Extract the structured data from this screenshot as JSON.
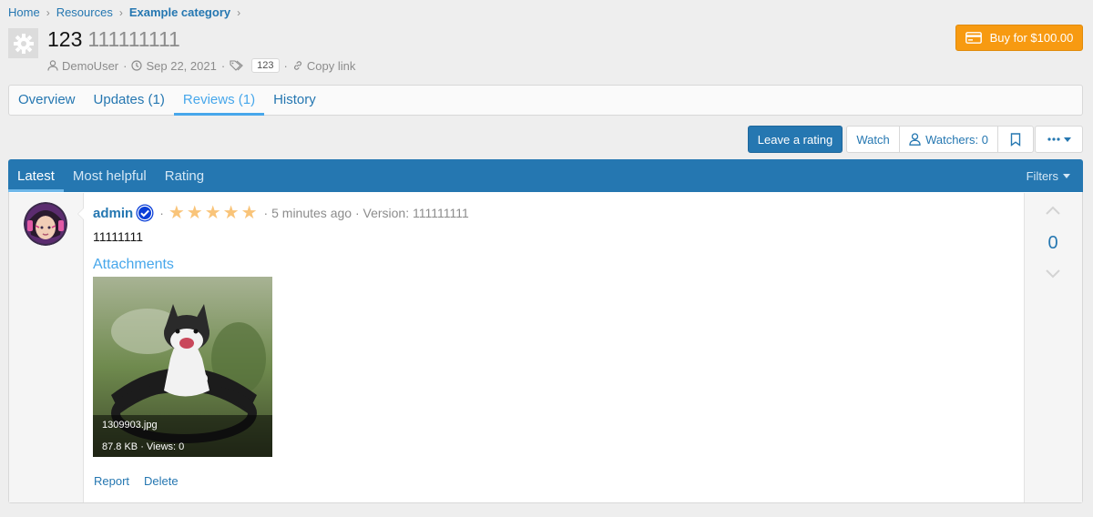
{
  "breadcrumb": [
    {
      "label": "Home",
      "bold": false
    },
    {
      "label": "Resources",
      "bold": false
    },
    {
      "label": "Example category",
      "bold": true
    }
  ],
  "resource": {
    "name": "123",
    "version": "111111111",
    "author": "DemoUser",
    "date": "Sep 22, 2021",
    "tag": "123",
    "copy_link": "Copy link",
    "buy_label": "Buy for $100.00"
  },
  "tabs": [
    {
      "label": "Overview",
      "active": false
    },
    {
      "label": "Updates (1)",
      "active": false
    },
    {
      "label": "Reviews (1)",
      "active": true
    },
    {
      "label": "History",
      "active": false
    }
  ],
  "actions_bar": {
    "leave_rating": "Leave a rating",
    "watch": "Watch",
    "watchers": "Watchers: 0"
  },
  "review_tabs": [
    {
      "label": "Latest",
      "active": true
    },
    {
      "label": "Most helpful",
      "active": false
    },
    {
      "label": "Rating",
      "active": false
    }
  ],
  "filters_label": "Filters",
  "review": {
    "author": "admin",
    "rating": 5,
    "time": "5 minutes ago",
    "version": "Version: 111111111",
    "text": "11111111",
    "attachments_title": "Attachments",
    "attachment": {
      "filename": "1309903.jpg",
      "stats": "87.8 KB · Views: 0"
    },
    "report": "Report",
    "delete": "Delete",
    "votes": "0"
  },
  "colors": {
    "primary": "#2577b1",
    "accent": "#47a7eb",
    "buy": "#f79a11",
    "star": "#f9c479",
    "verified": "#0a3fd8"
  }
}
